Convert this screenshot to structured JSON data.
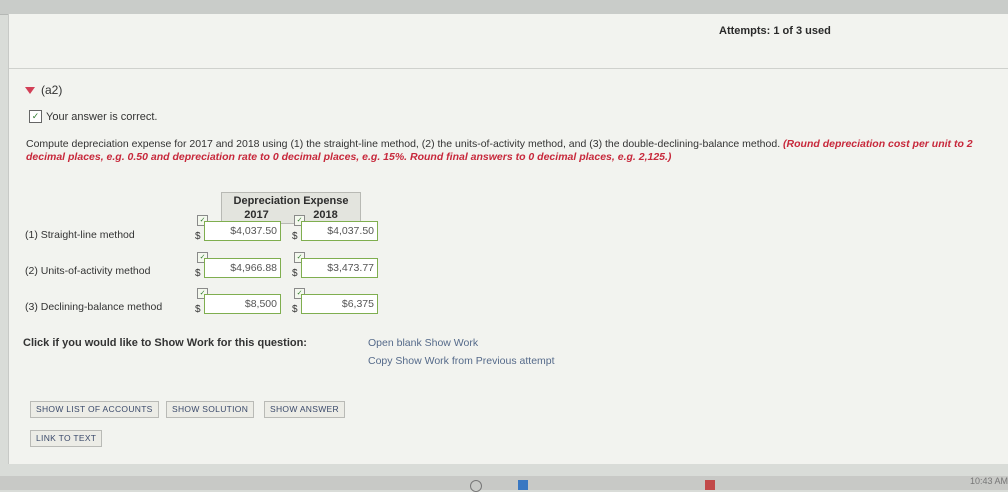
{
  "header": {
    "attempts": "Attempts: 1 of 3 used"
  },
  "part": {
    "label": "(a2)",
    "status": "Your answer is correct.",
    "instruction_plain": "Compute depreciation expense for 2017 and 2018 using (1) the straight-line method, (2) the units-of-activity method, and (3) the double-declining-balance method.",
    "instruction_note": "(Round depreciation cost per unit to 2 decimal places, e.g. 0.50 and depreciation rate to 0 decimal places, e.g. 15%. Round final answers to 0 decimal places, e.g. 2,125.)"
  },
  "table": {
    "title": "Depreciation Expense",
    "years": [
      "2017",
      "2018"
    ],
    "currency": "$",
    "rows": [
      {
        "label": "(1) Straight-line method",
        "v2017": "$4,037.50",
        "v2018": "$4,037.50"
      },
      {
        "label": "(2) Units-of-activity method",
        "v2017": "$4,966.88",
        "v2018": "$3,473.77"
      },
      {
        "label": "(3) Declining-balance method",
        "v2017": "$8,500",
        "v2018": "$6,375"
      }
    ]
  },
  "show_work": {
    "prompt": "Click if you would like to Show Work for this question:",
    "open_blank": "Open blank Show Work",
    "copy_previous": "Copy Show Work from Previous attempt"
  },
  "buttons": {
    "show_accounts": "SHOW LIST OF ACCOUNTS",
    "show_solution": "SHOW SOLUTION",
    "show_answer": "SHOW ANSWER",
    "link_to_text": "LINK TO TEXT"
  },
  "taskbar": {
    "time": "10:43 AM"
  },
  "colors": {
    "accent_red": "#c7283b",
    "correct_green": "#7fae4f",
    "link_blue": "#556a8a"
  }
}
